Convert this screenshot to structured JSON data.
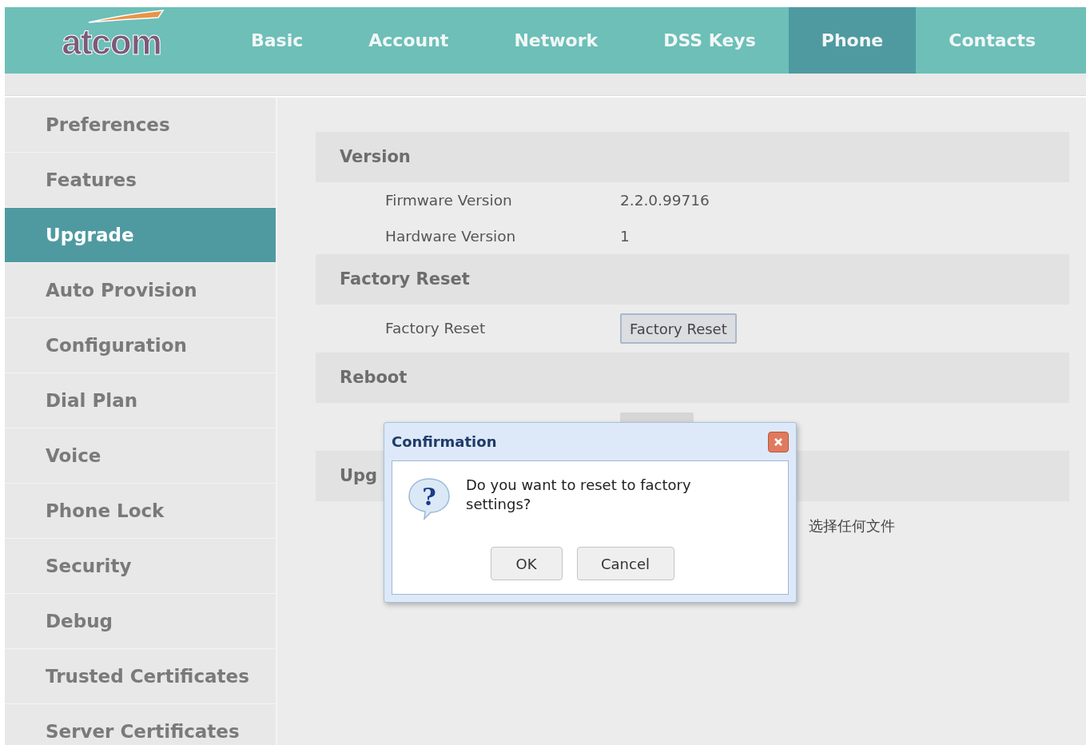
{
  "header": {
    "logo": "atcom",
    "nav": [
      {
        "label": "Basic",
        "selected": false
      },
      {
        "label": "Account",
        "selected": false
      },
      {
        "label": "Network",
        "selected": false
      },
      {
        "label": "DSS Keys",
        "selected": false
      },
      {
        "label": "Phone",
        "selected": true
      },
      {
        "label": "Contacts",
        "selected": false
      }
    ]
  },
  "sidebar": {
    "items": [
      {
        "label": "Preferences",
        "selected": false
      },
      {
        "label": "Features",
        "selected": false
      },
      {
        "label": "Upgrade",
        "selected": true
      },
      {
        "label": "Auto Provision",
        "selected": false
      },
      {
        "label": "Configuration",
        "selected": false
      },
      {
        "label": "Dial Plan",
        "selected": false
      },
      {
        "label": "Voice",
        "selected": false
      },
      {
        "label": "Phone Lock",
        "selected": false
      },
      {
        "label": "Security",
        "selected": false
      },
      {
        "label": "Debug",
        "selected": false
      },
      {
        "label": "Trusted Certificates",
        "selected": false
      },
      {
        "label": "Server Certificates",
        "selected": false
      }
    ]
  },
  "sections": [
    {
      "title": "Version",
      "rows": [
        {
          "kind": "text",
          "label": "Firmware Version",
          "value": "2.2.0.99716"
        },
        {
          "kind": "text",
          "label": "Hardware Version",
          "value": "1"
        }
      ]
    },
    {
      "title": "Factory Reset",
      "rows": [
        {
          "kind": "button",
          "label": "Factory Reset",
          "value": "Factory Reset"
        }
      ]
    },
    {
      "title": "Reboot",
      "rows": [
        {
          "kind": "covered-button"
        }
      ]
    },
    {
      "title": "Upg",
      "rows": [
        {
          "kind": "file",
          "value": "选择任何文件"
        }
      ]
    }
  ],
  "dialog": {
    "title": "Confirmation",
    "icon_glyph": "?",
    "message": "Do you want to reset to factory settings?",
    "buttons": [
      "OK",
      "Cancel"
    ]
  }
}
